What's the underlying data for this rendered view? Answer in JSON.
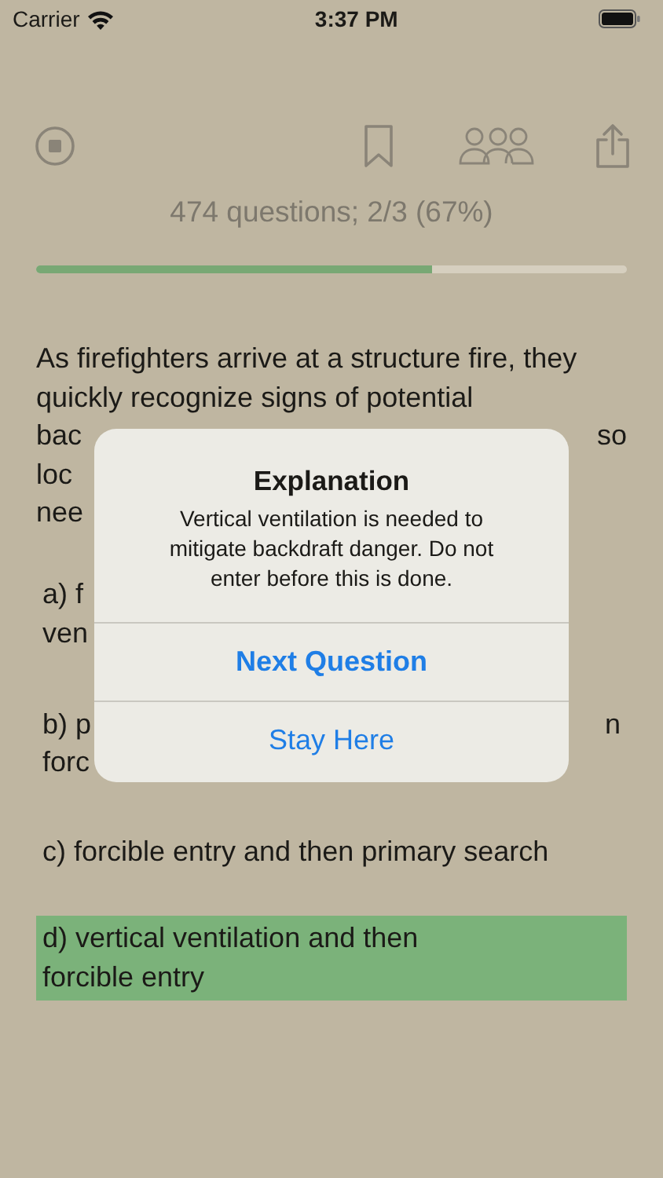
{
  "status_bar": {
    "carrier": "Carrier",
    "time": "3:37 PM"
  },
  "toolbar": {
    "buttons": [
      {
        "kind": "stop"
      },
      {
        "kind": "bookmark"
      },
      {
        "kind": "people"
      },
      {
        "kind": "share"
      }
    ]
  },
  "progress": {
    "text": "474 questions; 2/3 (67%)",
    "level": 0.67
  },
  "question": {
    "lines": [
      {
        "left": "As firefighters arrive at a structure fire, they"
      },
      {
        "left": "quickly recognize signs of potential"
      },
      {
        "left": "bac",
        "right": "so"
      },
      {
        "left": "loc"
      },
      {
        "left": "nee"
      }
    ]
  },
  "answers": [
    {
      "lines": [
        {
          "left": "a) f"
        },
        {
          "left": "ven"
        }
      ],
      "correct": false
    },
    {
      "lines": [
        {
          "left": "b) p",
          "right": "n"
        },
        {
          "left": "forc"
        }
      ],
      "correct": false
    },
    {
      "lines": [
        {
          "left": "c) forcible entry and then primary search"
        }
      ],
      "correct": false
    },
    {
      "lines": [
        {
          "left": "d) vertical ventilation and then"
        },
        {
          "left": "forcible entry"
        }
      ],
      "correct": true
    }
  ],
  "alert": {
    "title": "Explanation",
    "message": "Vertical ventilation is needed to mitigate backdraft danger. Do not enter before this is done.",
    "actions": [
      {
        "label": "Next Question",
        "kind": "default"
      },
      {
        "label": "Stay Here",
        "kind": "normal"
      }
    ]
  }
}
